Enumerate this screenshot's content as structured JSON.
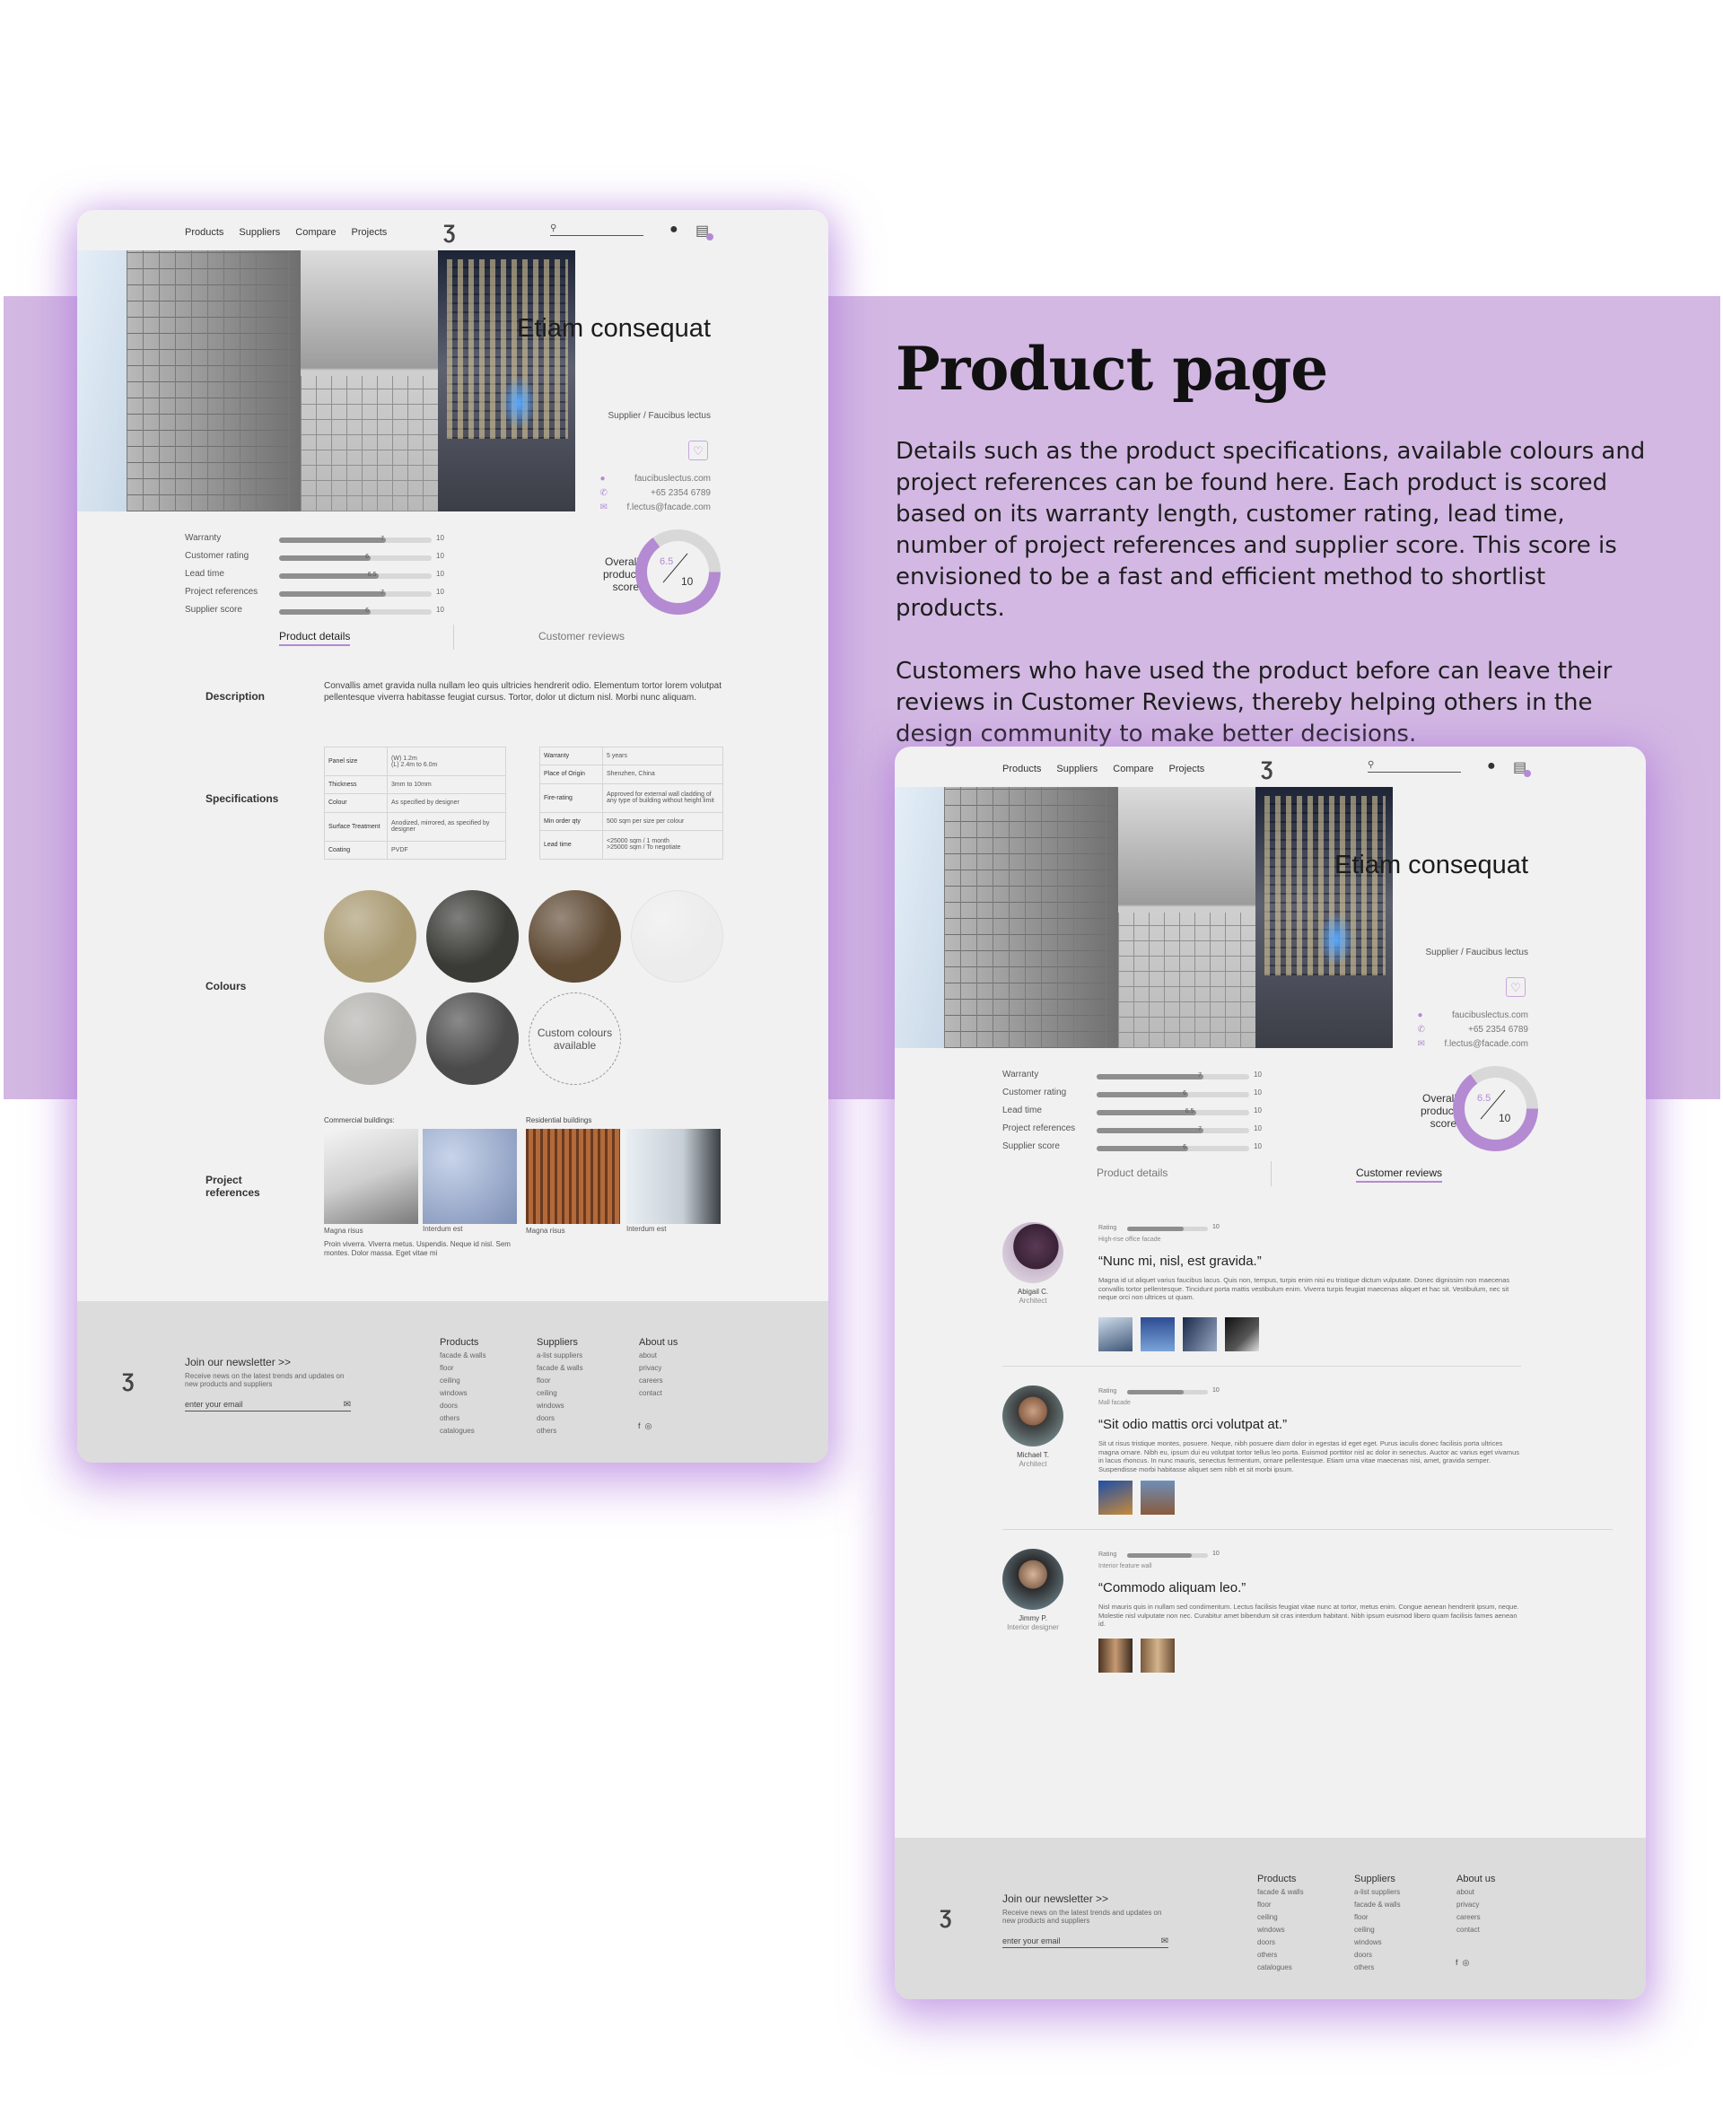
{
  "band": {
    "title": "Product page",
    "para1": "Details such as the product specifications, available colours and project references can be found here. Each product is scored based on its warranty length, customer rating, lead time, number of project references and supplier score. This score is envisioned to be a fast and efficient method to shortlist products.",
    "para2": "Customers who have used the product before can leave their reviews in Customer Reviews, thereby helping others in the design community to make better decisions."
  },
  "nav": {
    "links": [
      "Products",
      "Suppliers",
      "Compare",
      "Projects"
    ],
    "logo": "Ʒ",
    "user_icon": "user-icon",
    "cart_icon": "shortlist-icon"
  },
  "product": {
    "title": "Etiam consequat",
    "subtitle": "Supplier / Faucibus lectus",
    "website": "faucibuslectus.com",
    "phone": "+65 2354 6789",
    "email": "f.lectus@facade.com",
    "accent": "#b48ad2"
  },
  "metrics": [
    {
      "label": "Warranty",
      "value": 7,
      "value_label": "7",
      "max": "10"
    },
    {
      "label": "Customer rating",
      "value": 6,
      "value_label": "6",
      "max": "10"
    },
    {
      "label": "Lead time",
      "value": 6.5,
      "value_label": "6.5",
      "max": "10"
    },
    {
      "label": "Project references",
      "value": 7,
      "value_label": "7",
      "max": "10"
    },
    {
      "label": "Supplier score",
      "value": 6,
      "value_label": "6",
      "max": "10"
    }
  ],
  "score": {
    "label": "Overall product score",
    "value": "6.5",
    "max": "10",
    "fraction": 0.65
  },
  "tabs": {
    "details": "Product details",
    "reviews": "Customer reviews"
  },
  "details": {
    "description_label": "Description",
    "description": "Convallis amet gravida nulla nullam leo quis ultricies hendrerit odio. Elementum tortor lorem volutpat pellentesque viverra habitasse feugiat cursus. Tortor, dolor ut dictum nisl. Morbi nunc aliquam.",
    "spec_label": "Specifications",
    "spec_left": [
      [
        "Panel size",
        "(W) 1.2m\n(L) 2.4m to 6.0m"
      ],
      [
        "Thickness",
        "3mm to 10mm"
      ],
      [
        "Colour",
        "As specified by designer"
      ],
      [
        "Surface Treatment",
        "Anodized, mirrored, as specified by designer"
      ],
      [
        "Coating",
        "PVDF"
      ]
    ],
    "spec_right": [
      [
        "Warranty",
        "5 years"
      ],
      [
        "Place of Origin",
        "Shenzhen, China"
      ],
      [
        "Fire-rating",
        "Approved for external wall cladding of any type of building without height limit"
      ],
      [
        "Min order qty",
        "500 sqm per size per colour"
      ],
      [
        "Lead time",
        "<25000 sqm / 1 month\n>25000 sqm / To negotiate"
      ]
    ],
    "colours_label": "Colours",
    "colours": [
      "#a99a72",
      "#3a3a36",
      "#5f4a34",
      "#ececec",
      "#b3b2ae",
      "#4b4b4b"
    ],
    "custom_colour": "Custom colours available",
    "refs_label": "Project references",
    "commercial": "Commercial buildings:",
    "residential": "Residential buildings",
    "ref_captions": [
      "Magna risus",
      "Interdum est",
      "Magna risus",
      "Interdum est"
    ],
    "ref_desc": "Proin viverra. Viverra metus. Uspendis. Neque id nisl. Sem montes. Dolor massa. Eget vitae mi"
  },
  "reviews": [
    {
      "name": "Abigail C.",
      "role": "Architect",
      "rating_label": "Rating",
      "rating": 0.7,
      "max": "10",
      "project": "High-rise office facade",
      "quote": "“Nunc mi, nisl, est gravida.”",
      "body": "Magna id ut aliquet varius faucibus lacus. Quis non, tempus, turpis enim nisi eu tristique dictum vulputate. Donec dignissim non maecenas convallis tortor pellentesque. Tincidunt porta mattis vestibulum enim. Viverra turpis feugiat maecenas aliquet et hac sit. Vestibulum, nec sit neque orci non ultrices ut quam."
    },
    {
      "name": "Michael T.",
      "role": "Architect",
      "rating_label": "Rating",
      "rating": 0.7,
      "max": "10",
      "project": "Mall facade",
      "quote": "“Sit odio mattis orci volutpat at.”",
      "body": "Sit ut risus tristique montes, posuere. Neque, nibh posuere diam dolor in egestas id eget eget. Purus iaculis donec facilisis porta ultrices magna ornare. Nibh eu, ipsum dui eu volutpat tortor tellus leo porta. Euismod porttitor nisl ac dolor in senectus. Auctor ac varius eget vivamus in lacus rhoncus. In nunc mauris, senectus fermentum, ornare pellentesque. Etiam urna vitae maecenas nisi, amet, gravida semper. Suspendisse morbi habitasse aliquet sem nibh et sit morbi ipsum."
    },
    {
      "name": "Jimmy P.",
      "role": "Interior designer",
      "rating_label": "Rating",
      "rating": 0.8,
      "max": "10",
      "project": "Interior feature wall",
      "quote": "“Commodo aliquam leo.”",
      "body": "Nisl mauris quis in nullam sed condimentum. Lectus facilisis feugiat vitae nunc at tortor, metus enim. Congue aenean hendrerit ipsum, neque. Molestie nisl vulputate non nec. Curabitur amet bibendum sit cras interdum habitant. Nibh ipsum euismod libero quam facilisis fames aenean id."
    }
  ],
  "footer": {
    "logo": "Ʒ",
    "newsletter_title": "Join our newsletter >>",
    "newsletter_sub": "Receive news on the latest trends and updates on new products and suppliers",
    "email_placeholder": "enter your email",
    "cols": [
      {
        "title": "Products",
        "items": [
          "facade & walls",
          "floor",
          "ceiling",
          "windows",
          "doors",
          "others",
          "catalogues"
        ]
      },
      {
        "title": "Suppliers",
        "items": [
          "a-list suppliers",
          "facade & walls",
          "floor",
          "ceiling",
          "windows",
          "doors",
          "others"
        ]
      },
      {
        "title": "About us",
        "items": [
          "about",
          "privacy",
          "careers",
          "contact"
        ]
      }
    ],
    "social": [
      "f",
      "◎"
    ]
  }
}
